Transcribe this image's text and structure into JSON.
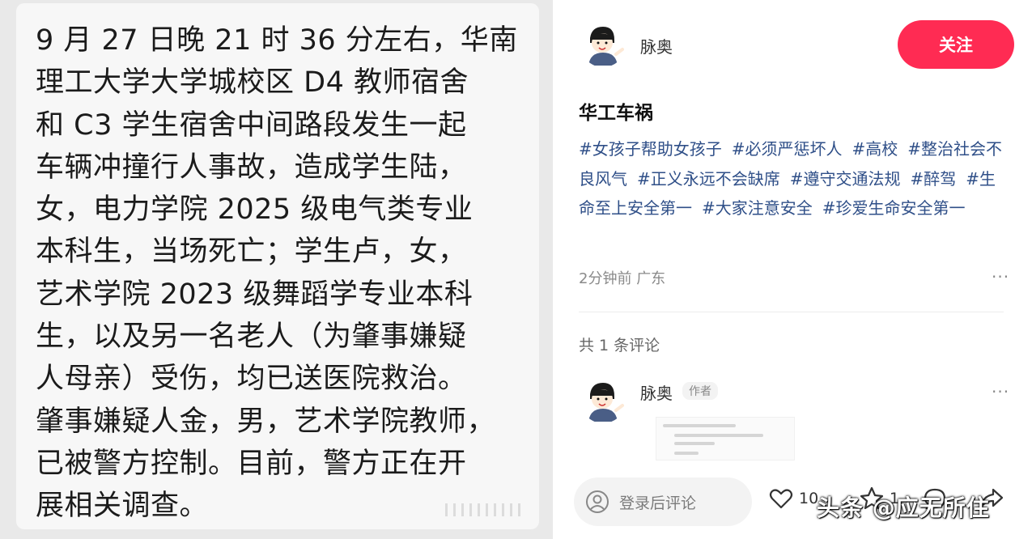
{
  "article": {
    "text": "9 月 27 日晚 21 时 36 分左右，华南\n理工大学大学城校区 D4 教师宿舍\n和 C3 学生宿舍中间路段发生一起\n车辆冲撞行人事故，造成学生陆，\n女，电力学院 2025 级电气类专业\n本科生，当场死亡；学生卢，女，\n艺术学院 2023 级舞蹈学专业本科\n生，以及另一名老人（为肇事嫌疑\n人母亲）受伤，均已送医院救治。\n肇事嫌疑人金，男，艺术学院教师，\n已被警方控制。目前，警方正在开\n展相关调查。"
  },
  "post": {
    "author": "脉奥",
    "follow_label": "关注",
    "title": "华工车祸",
    "tags": [
      "#女孩子帮助女孩子",
      "#必须严惩坏人",
      "#高校",
      "#整治社会不良风气",
      "#正义永远不会缺席",
      "#遵守交通法规",
      "#醉驾",
      "#生命至上安全第一",
      "#大家注意安全",
      "#珍爱生命安全第一"
    ],
    "time": "2分钟前",
    "location": "广东",
    "more": "···"
  },
  "comments": {
    "count_label": "共 1 条评论",
    "items": [
      {
        "author": "脉奥",
        "badge": "作者"
      }
    ]
  },
  "bottom_bar": {
    "input_placeholder": "登录后评论",
    "like_count": "10",
    "star_count": "1"
  },
  "watermark": "头条 @应无所住",
  "colors": {
    "accent": "#ff2b53",
    "tag": "#2f4f88"
  }
}
